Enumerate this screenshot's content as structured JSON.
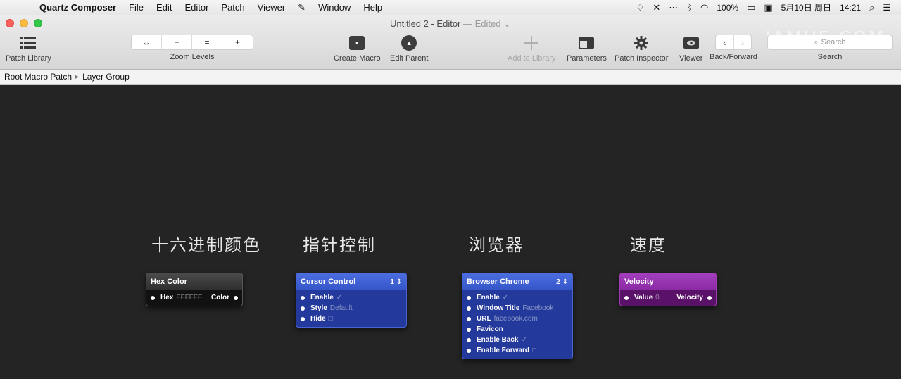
{
  "menubar": {
    "apple_icon": "apple-icon",
    "items": [
      "Quartz Composer",
      "File",
      "Edit",
      "Editor",
      "Patch",
      "Viewer",
      "Window",
      "Help"
    ],
    "status": {
      "battery": "100%",
      "date": "5月10日 周日",
      "time": "14:21"
    }
  },
  "window": {
    "title": "Untitled 2 - Editor",
    "edited_label": "Edited"
  },
  "watermark": "IAMUE.COM",
  "toolbar": {
    "patch_library_label": "Patch Library",
    "zoom_buttons": [
      "↔",
      "−",
      "=",
      "+"
    ],
    "zoom_levels_label": "Zoom Levels",
    "create_macro_label": "Create Macro",
    "edit_parent_label": "Edit Parent",
    "add_to_library_label": "Add to Library",
    "parameters_label": "Parameters",
    "patch_inspector_label": "Patch Inspector",
    "viewer_label": "Viewer",
    "back_forward_label": "Back/Forward",
    "search_placeholder": "Search",
    "search_label": "Search"
  },
  "breadcrumb": {
    "items": [
      "Root Macro Patch",
      "Layer Group"
    ]
  },
  "canvas": {
    "labels": [
      "十六进制颜色",
      "指针控制",
      "浏览器",
      "速度"
    ],
    "patches": {
      "hex_color": {
        "title": "Hex Color",
        "ports": [
          {
            "name": "Hex",
            "value": "FFFFFF",
            "output": "Color"
          }
        ]
      },
      "cursor_control": {
        "title": "Cursor Control",
        "count": "1 ⇕",
        "ports": [
          {
            "name": "Enable",
            "value": "✓"
          },
          {
            "name": "Style",
            "value": "Default"
          },
          {
            "name": "Hide",
            "value": "□"
          }
        ]
      },
      "browser_chrome": {
        "title": "Browser Chrome",
        "count": "2 ⇕",
        "ports": [
          {
            "name": "Enable",
            "value": "✓"
          },
          {
            "name": "Window Title",
            "value": "Facebook"
          },
          {
            "name": "URL",
            "value": "facebook.com"
          },
          {
            "name": "Favicon",
            "value": ""
          },
          {
            "name": "Enable Back",
            "value": "✓"
          },
          {
            "name": "Enable Forward",
            "value": "□"
          }
        ]
      },
      "velocity": {
        "title": "Velocity",
        "ports": [
          {
            "name": "Value",
            "value": "0",
            "output": "Velocity"
          }
        ]
      }
    }
  }
}
